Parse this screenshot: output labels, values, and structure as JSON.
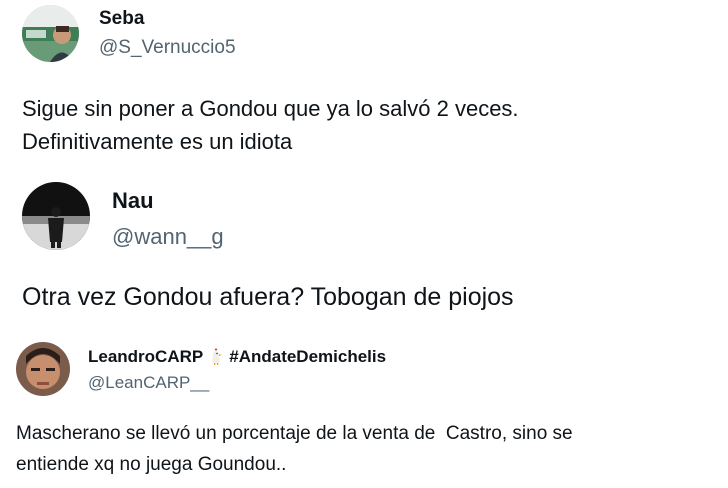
{
  "tweets": [
    {
      "name": "Seba",
      "handle": "@S_Vernuccio5",
      "text_lines": [
        "Sigue sin poner a Gondou que ya lo salvó 2 veces.",
        "Definitivamente es un idiota"
      ]
    },
    {
      "name": "Nau",
      "handle": "@wann__g",
      "text_lines": [
        "Otra vez Gondou afuera? Tobogan de piojos"
      ]
    },
    {
      "name": "LeandroCARP",
      "name_emoji_icon": "chicken-icon",
      "name_hashtag": "#AndateDemichelis",
      "handle": "@LeanCARP__",
      "text_lines": [
        "Mascherano se llevó un porcentaje de la venta de  Castro, sino se",
        "entiende xq no juega Goundou.."
      ]
    }
  ],
  "colors": {
    "text": "#0f1419",
    "handle": "#536471",
    "background": "#ffffff"
  }
}
